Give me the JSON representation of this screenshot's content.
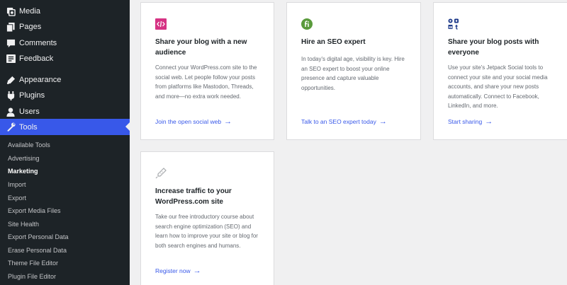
{
  "sidebar": {
    "menu": [
      {
        "label": "Media",
        "icon": "media-icon"
      },
      {
        "label": "Pages",
        "icon": "pages-icon"
      },
      {
        "label": "Comments",
        "icon": "comments-icon"
      },
      {
        "label": "Feedback",
        "icon": "feedback-icon"
      },
      {
        "label": "Appearance",
        "icon": "appearance-icon"
      },
      {
        "label": "Plugins",
        "icon": "plugins-icon"
      },
      {
        "label": "Users",
        "icon": "users-icon"
      },
      {
        "label": "Tools",
        "icon": "tools-icon"
      }
    ],
    "submenu": [
      "Available Tools",
      "Advertising",
      "Marketing",
      "Import",
      "Export",
      "Export Media Files",
      "Site Health",
      "Export Personal Data",
      "Erase Personal Data",
      "Theme File Editor",
      "Plugin File Editor"
    ],
    "active_menu": "Tools",
    "current_submenu": "Marketing"
  },
  "cards": [
    {
      "icon": "share-audience-icon",
      "title": "Share your blog with a new audience",
      "body": "Connect your WordPress.com site to the social web. Let people follow your posts from platforms like Mastodon, Threads, and more—no extra work needed.",
      "link": "Join the open social web"
    },
    {
      "icon": "seo-expert-icon",
      "title": "Hire an SEO expert",
      "body": "In today's digital age, visibility is key. Hire an SEO expert to boost your online presence and capture valuable opportunities.",
      "link": "Talk to an SEO expert today"
    },
    {
      "icon": "social-networks-icon",
      "title": "Share your blog posts with everyone",
      "body": "Use your site's Jetpack Social tools to connect your site and your social media accounts, and share your new posts automatically. Connect to Facebook, LinkedIn, and more.",
      "link": "Start sharing"
    },
    {
      "icon": "traffic-course-icon",
      "title": "Increase traffic to your WordPress.com site",
      "body": "Take our free introductory course about search engine optimization (SEO) and learn how to improve your site or blog for both search engines and humans.",
      "link": "Register now"
    }
  ],
  "colors": {
    "sidebar_bg": "#1d2327",
    "accent": "#3858e9",
    "share_icon": "#d63384",
    "seo_icon": "#5a9b3c"
  }
}
